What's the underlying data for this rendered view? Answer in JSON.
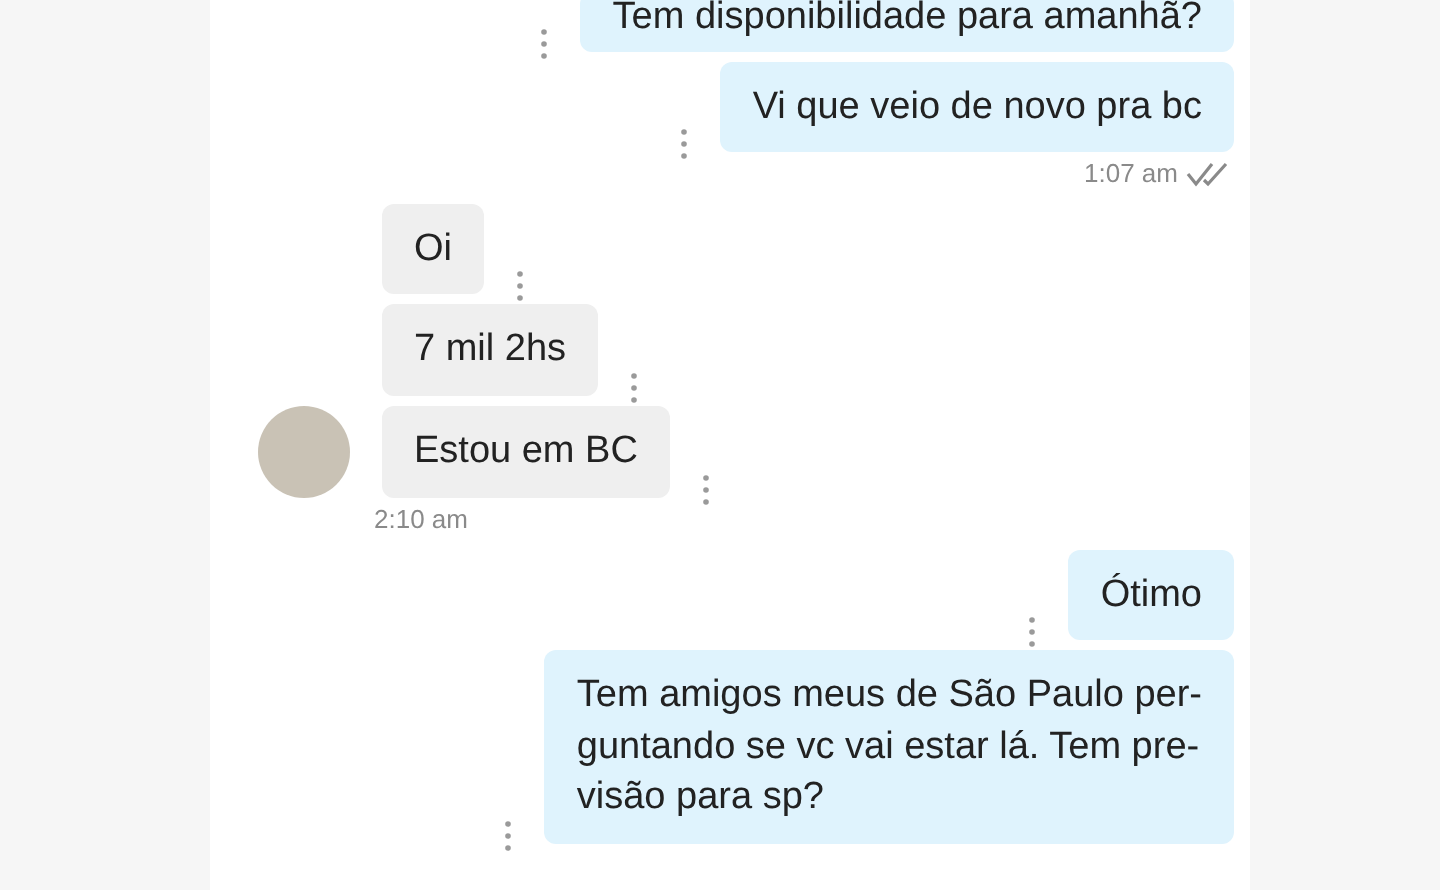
{
  "messages": [
    {
      "kind": "sent",
      "text": "Tem disponibilidade para amanhã?"
    },
    {
      "kind": "sent",
      "text": "Vi que veio de novo pra bc"
    },
    {
      "kind": "time_sent",
      "text": "1:07 am",
      "read": true
    },
    {
      "kind": "received",
      "text": "Oi"
    },
    {
      "kind": "received",
      "text": "7 mil 2hs"
    },
    {
      "kind": "received",
      "text": "Estou em BC",
      "avatar": true
    },
    {
      "kind": "time_received",
      "text": "2:10 am"
    },
    {
      "kind": "sent",
      "text": "Ótimo"
    },
    {
      "kind": "sent",
      "text": "Tem amigos meus de São Paulo per-\nguntando se vc vai estar lá. Tem pre-\nvisão para sp?"
    }
  ]
}
